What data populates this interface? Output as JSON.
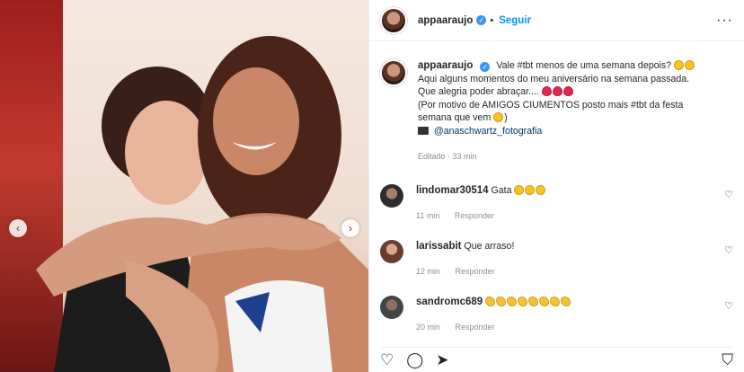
{
  "header": {
    "username": "appaaraujo",
    "follow_label": "Seguir",
    "more_icon": "more-icon"
  },
  "caption": {
    "username": "appaaraujo",
    "line1": "Vale #tbt menos de uma semana depois?",
    "line2": "Aqui alguns momentos do meu aniversário na semana passada.",
    "line3": "Que alegria poder abraçar....",
    "line4": "(Por motivo de AMIGOS CIUMENTOS posto mais #tbt da festa",
    "line5": "semana que vem",
    "line5_end": ")",
    "credit": "@anaschwartz_fotografia",
    "edited": "Editado · 33 min"
  },
  "comments": [
    {
      "username": "lindomar30514",
      "text": "Gata",
      "time": "11 min",
      "reply": "Responder"
    },
    {
      "username": "larissabit",
      "text": "Que arraso!",
      "time": "12 min",
      "reply": "Responder"
    },
    {
      "username": "sandromc689",
      "text": "",
      "time": "20 min",
      "reply": "Responder"
    }
  ],
  "icons": {
    "like": "heart-icon",
    "comment": "comment-icon",
    "share": "share-icon",
    "save": "bookmark-icon"
  }
}
